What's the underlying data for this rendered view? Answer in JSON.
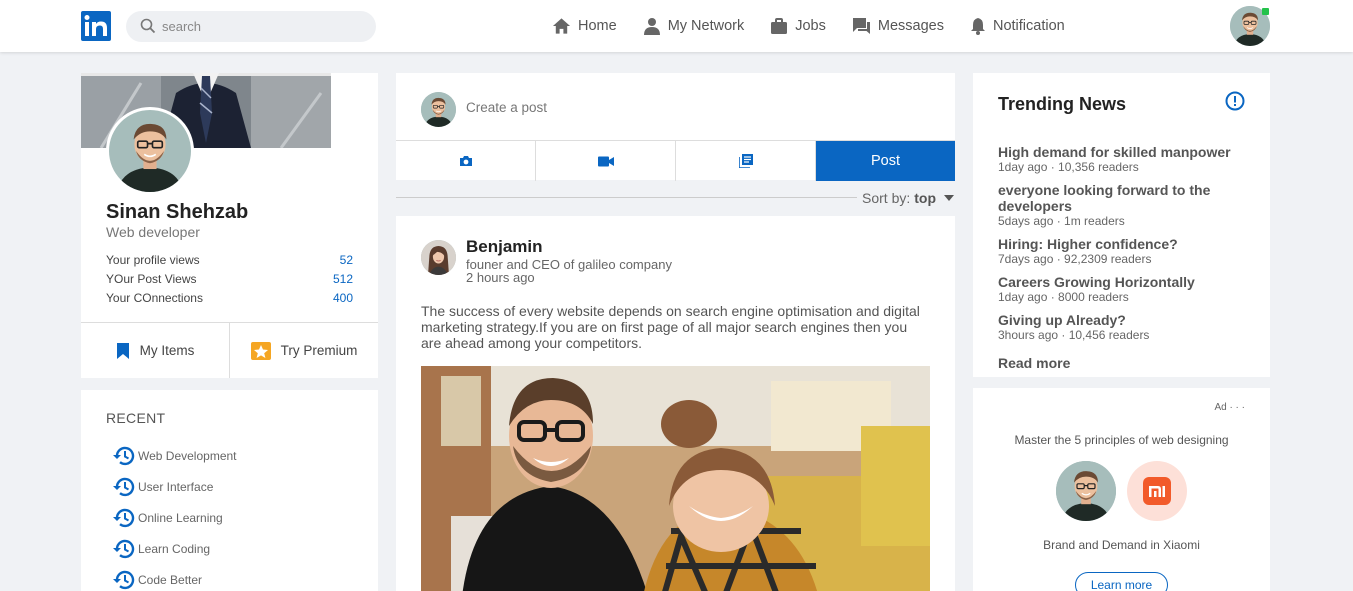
{
  "colors": {
    "accent": "#0a66c2",
    "online": "#24c24b",
    "brand_ad": "#f25a2a"
  },
  "navbar": {
    "logo_icon": "linkedin-logo",
    "search": {
      "placeholder": "search",
      "value": ""
    },
    "links": [
      {
        "label": "Home",
        "icon": "home-icon"
      },
      {
        "label": "My Network",
        "icon": "person-icon"
      },
      {
        "label": "Jobs",
        "icon": "briefcase-icon"
      },
      {
        "label": "Messages",
        "icon": "message-icon"
      },
      {
        "label": "Notification",
        "icon": "bell-icon"
      }
    ]
  },
  "profile": {
    "name": "Sinan Shehzab",
    "role": "Web developer",
    "stats": [
      {
        "label": "Your profile views",
        "value": "52"
      },
      {
        "label": "YOur Post Views",
        "value": "512"
      },
      {
        "label": "Your COnnections",
        "value": "400"
      }
    ],
    "actions": {
      "items": "My Items",
      "premium": "Try Premium"
    }
  },
  "recent": {
    "title": "RECENT",
    "items": [
      "Web Development",
      "User Interface",
      "Online Learning",
      "Learn Coding",
      "Code Better"
    ]
  },
  "create_post": {
    "placeholder": "Create a post",
    "post_label": "Post"
  },
  "sort": {
    "label": "Sort by:",
    "value": "top"
  },
  "feed_post": {
    "author": "Benjamin",
    "author_title": "founer and CEO of galileo company",
    "time": "2 hours ago",
    "text": "The success of every website depends on search engine optimisation and digital marketing strategy.If you are on first page of all major search engines then you are ahead among your competitors."
  },
  "trending": {
    "title": "Trending News",
    "items": [
      {
        "headline": "High demand for skilled manpower",
        "meta": "1day ago · 10,356 readers"
      },
      {
        "headline": "everyone looking forward to the developers",
        "meta": "5days ago · 1m readers"
      },
      {
        "headline": "Hiring: Higher confidence?",
        "meta": "7days ago · 92,2309 readers"
      },
      {
        "headline": "Careers Growing Horizontally",
        "meta": "1day ago · 8000 readers"
      },
      {
        "headline": "Giving up Already?",
        "meta": "3hours ago · 10,456 readers"
      }
    ],
    "read_more": "Read more"
  },
  "ad": {
    "label": "Ad · · ·",
    "text": "Master the 5 principles of web designing",
    "sub": "Brand and Demand in Xiaomi",
    "button": "Learn more"
  }
}
